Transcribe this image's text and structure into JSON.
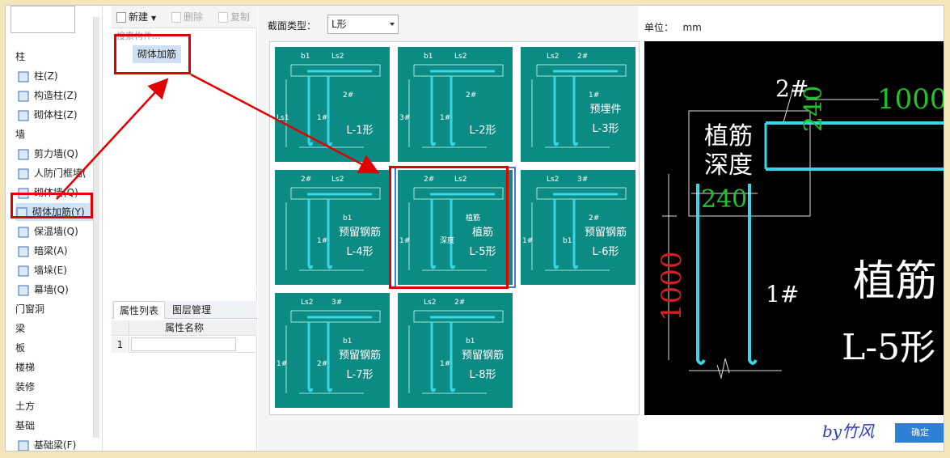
{
  "tree": {
    "items": [
      {
        "label": "柱",
        "kind": "cat"
      },
      {
        "label": "柱(Z)",
        "kind": "leaf",
        "icon": "column-icon"
      },
      {
        "label": "构造柱(Z)",
        "kind": "leaf",
        "icon": "construct-column-icon"
      },
      {
        "label": "砌体柱(Z)",
        "kind": "leaf",
        "icon": "masonry-column-icon"
      },
      {
        "label": "墙",
        "kind": "cat"
      },
      {
        "label": "剪力墙(Q)",
        "kind": "leaf",
        "icon": "shear-wall-icon"
      },
      {
        "label": "人防门框墙(",
        "kind": "leaf",
        "icon": "civil-defense-wall-icon"
      },
      {
        "label": "砌体墙(Q)",
        "kind": "leaf",
        "icon": "masonry-wall-icon"
      },
      {
        "label": "砌体加筋(Y)",
        "kind": "leaf",
        "icon": "masonry-rebar-icon",
        "selected": true
      },
      {
        "label": "保温墙(Q)",
        "kind": "leaf",
        "icon": "insulation-wall-icon"
      },
      {
        "label": "暗梁(A)",
        "kind": "leaf",
        "icon": "hidden-beam-icon"
      },
      {
        "label": "墙垛(E)",
        "kind": "leaf",
        "icon": "wall-pier-icon"
      },
      {
        "label": "幕墙(Q)",
        "kind": "leaf",
        "icon": "curtain-wall-icon"
      },
      {
        "label": "门窗洞",
        "kind": "cat"
      },
      {
        "label": "梁",
        "kind": "cat"
      },
      {
        "label": "板",
        "kind": "cat"
      },
      {
        "label": "楼梯",
        "kind": "cat"
      },
      {
        "label": "装修",
        "kind": "cat"
      },
      {
        "label": "土方",
        "kind": "cat"
      },
      {
        "label": "基础",
        "kind": "cat"
      },
      {
        "label": "基础梁(F)",
        "kind": "leaf",
        "icon": "foundation-beam-icon"
      }
    ]
  },
  "toolbar": {
    "new_label": "新建",
    "delete_label": "删除",
    "copy_label": "复制"
  },
  "component": {
    "search_placeholder": "搜索构件...",
    "item": "砌体加筋"
  },
  "props": {
    "tab1": "属性列表",
    "tab2": "图层管理",
    "col_name": "属性名称",
    "row1": "1"
  },
  "section": {
    "type_label": "截面类型：",
    "type_value": "L形",
    "unit_label": "单位：",
    "unit_value": "mm",
    "thumbs": [
      {
        "name": "L-1",
        "lines": [
          "L-1形"
        ],
        "dims": [
          "b1",
          "Ls2",
          "2#",
          "1#",
          "Ls1"
        ]
      },
      {
        "name": "L-2",
        "lines": [
          "L-2形"
        ],
        "dims": [
          "b1",
          "Ls2",
          "2#",
          "1#",
          "3#"
        ]
      },
      {
        "name": "L-3",
        "lines": [
          "预埋件",
          "L-3形"
        ],
        "dims": [
          "Ls2",
          "2#",
          "1#"
        ]
      },
      {
        "name": "L-4",
        "lines": [
          "预留钢筋",
          "L-4形"
        ],
        "dims": [
          "2#",
          "Ls2",
          "b1",
          "1#"
        ]
      },
      {
        "name": "L-5",
        "lines": [
          "植筋",
          "L-5形"
        ],
        "dims": [
          "2#",
          "Ls2",
          "植筋",
          "深度",
          "1#"
        ]
      },
      {
        "name": "L-6",
        "lines": [
          "预留钢筋",
          "L-6形"
        ],
        "dims": [
          "Ls2",
          "3#",
          "2#",
          "b1",
          "1#"
        ]
      },
      {
        "name": "L-7",
        "lines": [
          "预留钢筋",
          "L-7形"
        ],
        "dims": [
          "Ls2",
          "3#",
          "b1",
          "2#",
          "1#"
        ]
      },
      {
        "name": "L-8",
        "lines": [
          "预留钢筋",
          "L-8形"
        ],
        "dims": [
          "Ls2",
          "2#",
          "b1",
          "1#"
        ]
      }
    ]
  },
  "preview": {
    "top_bar": "2#",
    "top_len": "1000",
    "depth_l1": "植筋",
    "depth_l2": "深度",
    "vert_dim": "240",
    "horiz_dim": "240",
    "left_len": "1000",
    "vert_bar": "1#",
    "title1": "植筋",
    "title2": "L-5形"
  },
  "ok_label": "确定",
  "signature": "by竹风",
  "colors": {
    "teal": "#0c8b85",
    "rebar": "#38d7e8",
    "green": "#22c22a",
    "red": "#d42020",
    "annot": "#e00000"
  }
}
